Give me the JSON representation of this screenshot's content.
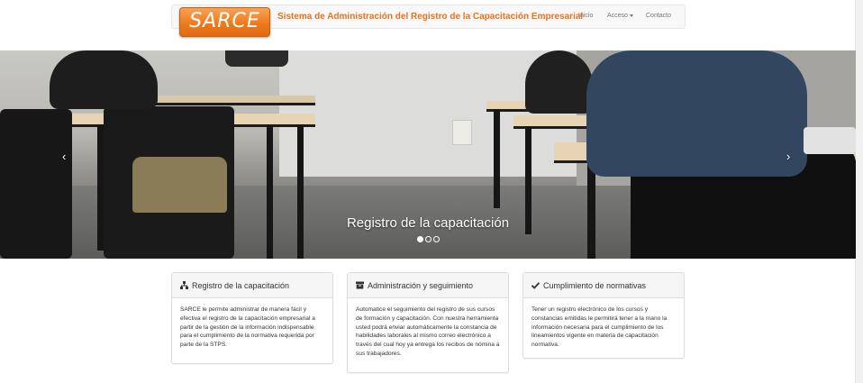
{
  "navbar": {
    "logo_text": "SARCE",
    "title": "Sistema de Administración del Registro de la Capacitación Empresarial",
    "links": {
      "inicio": "Inicio",
      "acceso": "Acceso",
      "contacto": "Contacto"
    }
  },
  "carousel": {
    "caption": "Registro de la capacitación",
    "prev_glyph": "‹",
    "next_glyph": "›",
    "slide_count": 3,
    "active_slide": 1
  },
  "panels": [
    {
      "icon": "sitemap-icon",
      "title": "Registro de la capacitación",
      "body": "SARCE le permite administrar de manera fácil y efectiva el registro de la capacitación empresarial a partir de la gestión de la información indispensable para el cumplimiento de la normativa requerida por parte de la STPS."
    },
    {
      "icon": "archive-icon",
      "title": "Administración y seguimiento",
      "body": "Automatice el seguimiento del registro de sus cursos de formación y capacitación. Con nuestra herramienta usted podrá enviar automáticamente la constancia de habilidades laborales al mismo correo electrónico a través del cual hoy ya entrega los recibos de nómina a sus trabajadores."
    },
    {
      "icon": "check-icon",
      "title": "Cumplimiento de normativas",
      "body": "Tener un registro electrónico de los cursos y constancias emitidas le permitirá tener a la mano la información necesaria para el cumplimiento de los lineamientos vigente en materia de capacitación normativa."
    }
  ],
  "colors": {
    "brand_orange": "#e9711c",
    "navbar_bg": "#f8f8f8",
    "panel_heading_bg": "#f5f5f5"
  }
}
